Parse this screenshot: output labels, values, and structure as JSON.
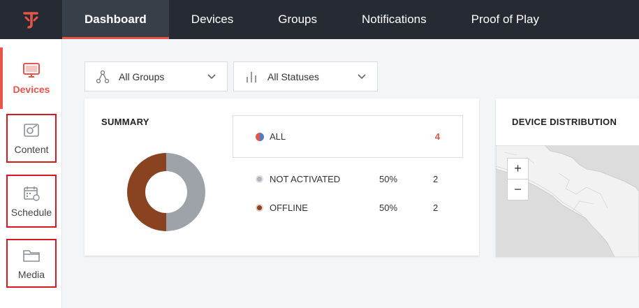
{
  "nav": {
    "tabs": [
      {
        "label": "Dashboard",
        "active": true
      },
      {
        "label": "Devices"
      },
      {
        "label": "Groups"
      },
      {
        "label": "Notifications"
      },
      {
        "label": "Proof of Play"
      }
    ]
  },
  "sidebar": {
    "items": [
      {
        "label": "Devices",
        "icon": "monitor-icon",
        "active": true
      },
      {
        "label": "Content",
        "icon": "content-icon"
      },
      {
        "label": "Schedule",
        "icon": "calendar-icon"
      },
      {
        "label": "Media",
        "icon": "folder-icon"
      }
    ]
  },
  "filters": {
    "groups": {
      "label": "All Groups",
      "icon": "groups-icon"
    },
    "statuses": {
      "label": "All Statuses",
      "icon": "status-bars-icon"
    }
  },
  "summary": {
    "title": "SUMMARY",
    "all": {
      "label": "ALL",
      "count": "4"
    },
    "rows": [
      {
        "label": "NOT ACTIVATED",
        "percent": "50%",
        "count": "2",
        "color": "#b0b4ba"
      },
      {
        "label": "OFFLINE",
        "percent": "50%",
        "count": "2",
        "color": "#8a4320"
      }
    ]
  },
  "distribution": {
    "title": "DEVICE DISTRIBUTION",
    "zoom_in": "+",
    "zoom_out": "−"
  },
  "colors": {
    "accent": "#e8534a",
    "nav_bg": "#262b33",
    "not_activated": "#9ea3a9",
    "offline": "#8a4320"
  }
}
